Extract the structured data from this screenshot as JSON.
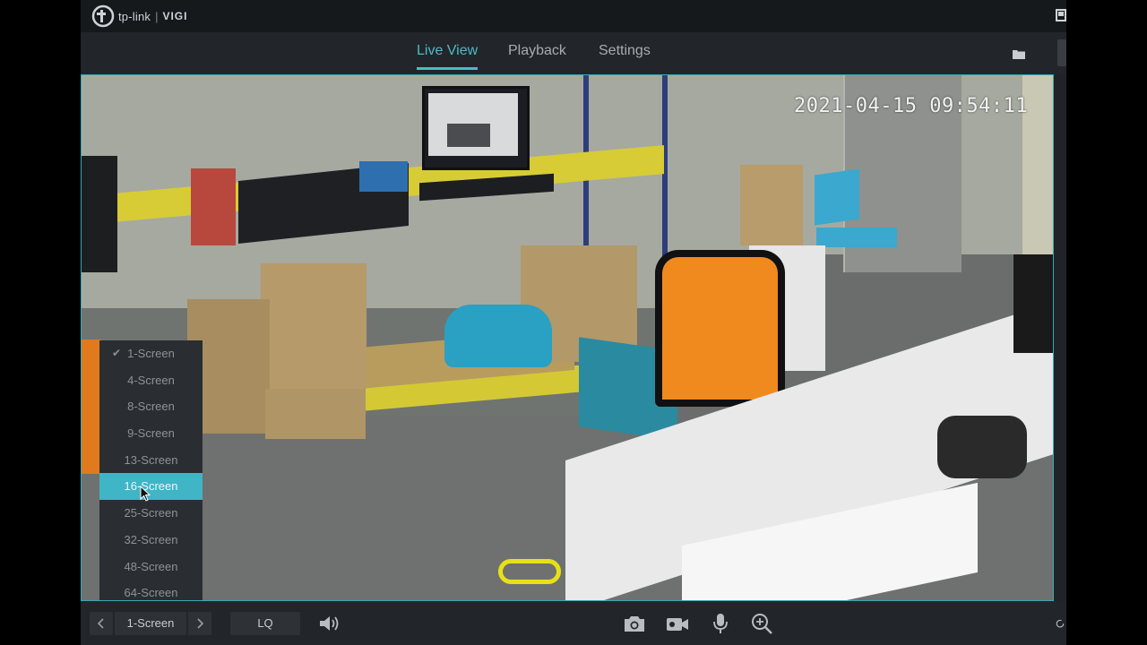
{
  "titlebar": {
    "brand": "tp-link",
    "product": "VIGI"
  },
  "nav": {
    "tabs": [
      {
        "label": "Live View",
        "active": true
      },
      {
        "label": "Playback",
        "active": false
      },
      {
        "label": "Settings",
        "active": false
      }
    ]
  },
  "video": {
    "timestamp": "2021-04-15 09:54:11"
  },
  "layout_menu": {
    "items": [
      "1-Screen",
      "4-Screen",
      "8-Screen",
      "9-Screen",
      "13-Screen",
      "16-Screen",
      "25-Screen",
      "32-Screen",
      "48-Screen",
      "64-Screen"
    ],
    "checked": "1-Screen",
    "highlighted": "16-Screen"
  },
  "toolbar": {
    "layout_value": "1-Screen",
    "quality_value": "LQ"
  },
  "colors": {
    "accent": "#3fb5c6",
    "background": "#202428"
  },
  "icons": [
    "tp-link-logo-icon",
    "window-icon",
    "folder-icon",
    "chevron-left-icon",
    "chevron-right-icon",
    "speaker-icon",
    "camera-icon",
    "video-record-icon",
    "microphone-icon",
    "zoom-in-icon",
    "refresh-icon"
  ]
}
